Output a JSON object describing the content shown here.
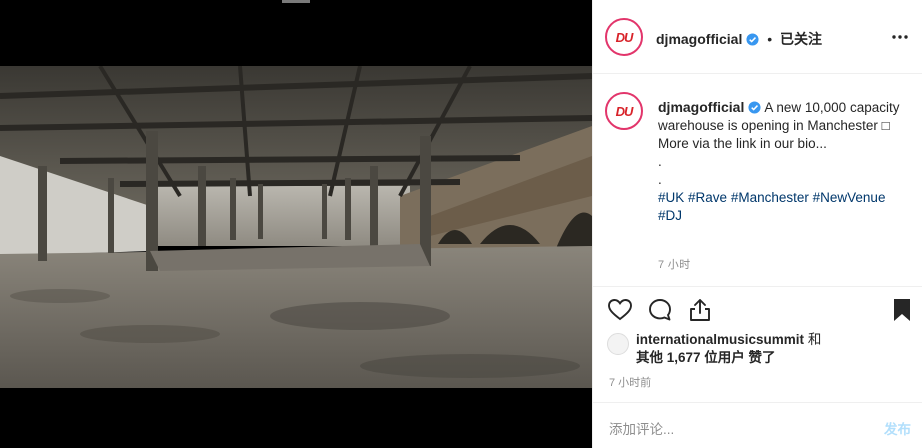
{
  "post": {
    "username": "djmagofficial",
    "separator": "•",
    "follow_label": "已关注",
    "avatar_text": "DU",
    "caption_text": "A new 10,000 capacity warehouse is opening in Manchester □ More via the link in our bio...",
    "caption_dots": [
      ".",
      " ."
    ],
    "hashtags": [
      "#UK",
      "#Rave",
      "#Manchester",
      "#NewVenue",
      "#DJ"
    ],
    "caption_time": "7 小时",
    "likes_prefix_user": "internationalmusicsummit",
    "likes_and": "和",
    "likes_line2": "其他 1,677 位用户 赞了",
    "post_time": "7 小时前",
    "comment_placeholder": "添加评论...",
    "post_button": "发布"
  },
  "icons": {
    "verified": "verified-badge-icon",
    "more": "more-options-icon",
    "like": "heart-icon",
    "comment": "comment-icon",
    "share": "share-icon",
    "save": "bookmark-icon"
  },
  "colors": {
    "brand_red": "#d8232a",
    "ring": "#e2356b",
    "hashtag": "#00376b",
    "muted": "#8e8e8e"
  }
}
